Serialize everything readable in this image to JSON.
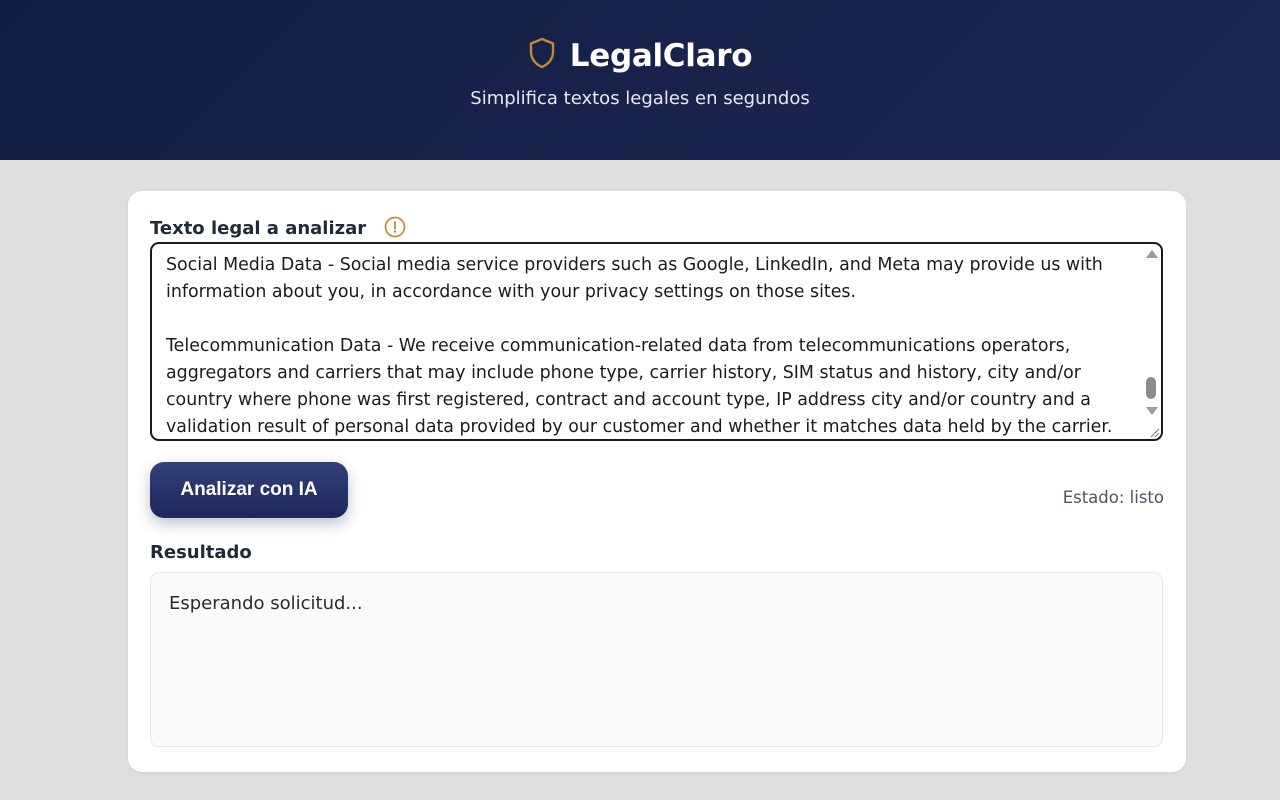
{
  "header": {
    "brand_name": "LegalClaro",
    "tagline": "Simplifica textos legales en segundos",
    "icon": "shield-icon",
    "accent_color": "#c58a30",
    "background_color": "#121d45"
  },
  "form": {
    "label": "Texto legal a analizar",
    "info_icon": "info-icon",
    "textarea_value": "Social Media Data - Social media service providers such as Google, LinkedIn, and Meta may provide us with information about you, in accordance with your privacy settings on those sites.\n\nTelecommunication Data - We receive communication-related data from telecommunications operators, aggregators and carriers that may include phone type, carrier history, SIM status and history, city and/or country where phone was first registered, contract and account type, IP address city and/or country and a validation result of personal data provided by our customer and whether it matches data held by the carrier."
  },
  "actions": {
    "analyze_label": "Analizar con IA",
    "status_text": "Estado: listo"
  },
  "result": {
    "label": "Resultado",
    "text": "Esperando solicitud..."
  }
}
